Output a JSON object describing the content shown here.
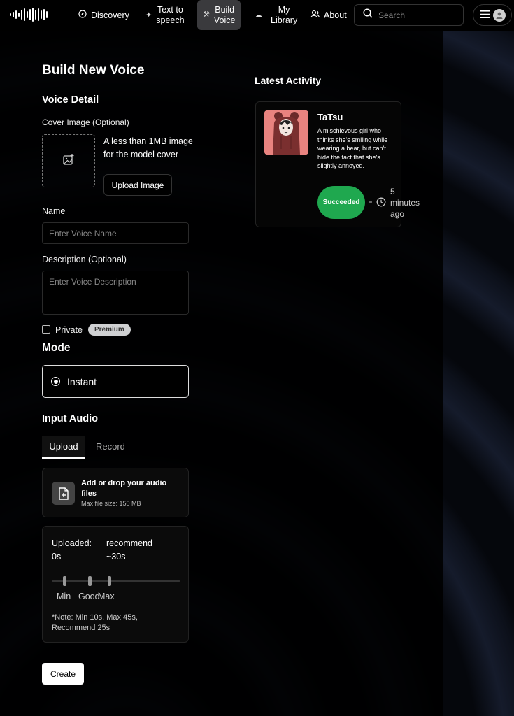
{
  "nav": {
    "items": [
      {
        "label": "Discovery",
        "icon": "compass-icon"
      },
      {
        "label": "Text to speech",
        "line1": "Text to",
        "line2": "speech",
        "icon": "sparkle-icon"
      },
      {
        "label": "Build Voice",
        "line1": "Build",
        "line2": "Voice",
        "icon": "wand-icon",
        "active": true
      },
      {
        "label": "My Library",
        "line1": "My",
        "line2": "Library",
        "icon": "cloud-icon"
      },
      {
        "label": "About",
        "icon": "users-icon"
      }
    ],
    "search_placeholder": "Search"
  },
  "form": {
    "title": "Build New Voice",
    "voice_detail": "Voice Detail",
    "cover_label": "Cover Image (Optional)",
    "cover_hint": "A less than 1MB image for the model cover",
    "upload_image": "Upload Image",
    "name_label": "Name",
    "name_placeholder": "Enter Voice Name",
    "desc_label": "Description (Optional)",
    "desc_placeholder": "Enter Voice Description",
    "private_label": "Private",
    "premium_badge": "Premium",
    "mode_heading": "Mode",
    "mode_option": "Instant",
    "input_audio": "Input Audio",
    "tabs": [
      "Upload",
      "Record"
    ],
    "drop_title": "Add or drop your audio files",
    "drop_sub": "Max file size: 150 MB",
    "uploaded_label": "Uploaded:",
    "uploaded_value": "0s",
    "recommend_label": "recommend",
    "recommend_value": "~30s",
    "slider_labels": [
      "Min",
      "Good",
      "Max"
    ],
    "note": "*Note: Min 10s, Max 45s, Recommend 25s",
    "create": "Create"
  },
  "activity": {
    "heading": "Latest Activity",
    "name": "TaTsu",
    "description": "A mischievous girl who thinks she's smiling while wearing a bear, but can't hide the fact that she's slightly annoyed.",
    "status": "Succeeded",
    "time_line1": "5",
    "time_line2": "minutes",
    "time_line3": "ago"
  },
  "colors": {
    "accent_green": "#1fa84f",
    "background": "#05070c",
    "thumbnail_bg": "#e8837f"
  }
}
